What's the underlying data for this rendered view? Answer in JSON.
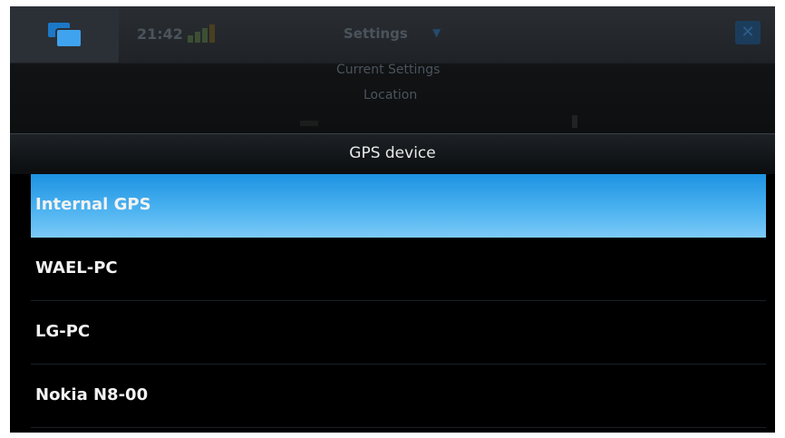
{
  "background": {
    "clock": "21:42",
    "title": "Settings",
    "items": [
      "Current Settings",
      "Location"
    ]
  },
  "dialog": {
    "title": "GPS device",
    "items": [
      {
        "label": "Internal GPS",
        "selected": true
      },
      {
        "label": "WAEL-PC",
        "selected": false
      },
      {
        "label": "LG-PC",
        "selected": false
      },
      {
        "label": "Nokia N8-00",
        "selected": false
      }
    ]
  },
  "colors": {
    "selection": "#3aa6ec",
    "background": "#000000",
    "title_text": "#e8e8e8"
  },
  "icons": {
    "task_switcher": "task-switcher-icon",
    "close": "close-icon",
    "signal": "signal-strength-icon",
    "dropdown": "chevron-down-icon"
  }
}
